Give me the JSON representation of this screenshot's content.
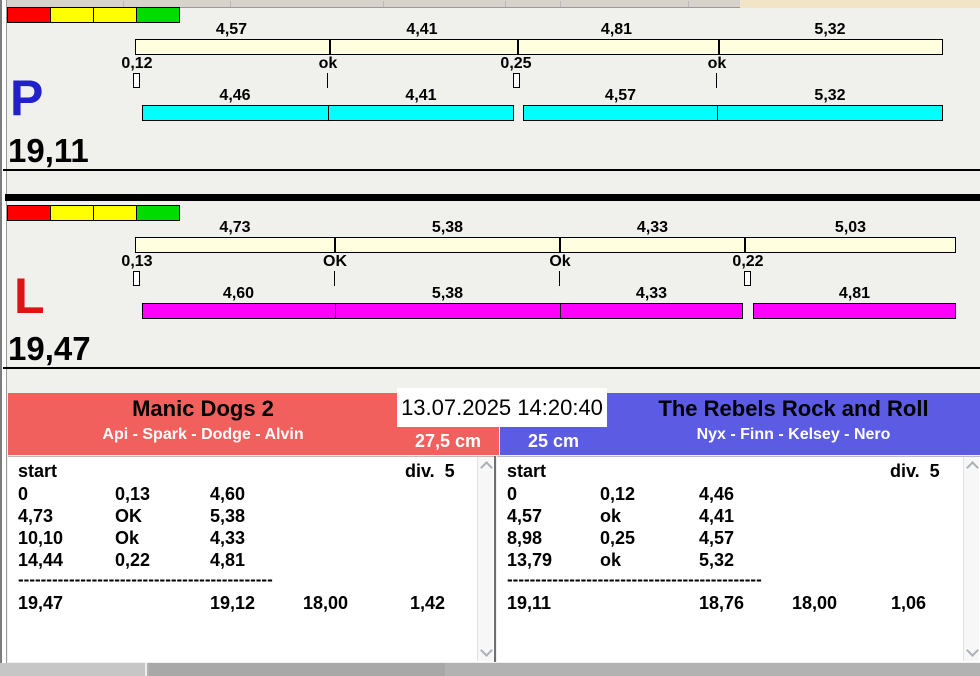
{
  "app": {
    "datetime": "13.07.2025 14:20:40",
    "colors": {
      "cream_bar": "#FFFFE0",
      "cyan_bar": "#00FFFF",
      "magenta_bar": "#FF00FF",
      "red_team": "#F2605E",
      "blue_team": "#5B5BE4",
      "p_letter": "#2020CC",
      "l_letter": "#DD1414"
    }
  },
  "lights": {
    "cells": [
      "#FF0000",
      "#FFFF00",
      "#FFFF00",
      "#00DC00"
    ]
  },
  "lane_p": {
    "letter": "P",
    "total": "19,11",
    "splits_top": [
      "4,57",
      "4,41",
      "4,81",
      "5,32"
    ],
    "marks": [
      "0,12",
      "ok",
      "0,25",
      "ok"
    ],
    "splits_bottom": [
      "4,46",
      "4,41",
      "4,57",
      "5,32"
    ]
  },
  "lane_l": {
    "letter": "L",
    "total": "19,47",
    "splits_top": [
      "4,73",
      "5,38",
      "4,33",
      "5,03"
    ],
    "marks": [
      "0,13",
      "OK",
      "Ok",
      "0,22"
    ],
    "splits_bottom": [
      "4,60",
      "5,38",
      "4,33",
      "4,81"
    ]
  },
  "left_team": {
    "name": "Manic Dogs 2",
    "dogs": "Api - Spark - Dodge - Alvin",
    "jump_height": "27,5 cm",
    "table": {
      "start_label": "start",
      "div_label": "div.  5",
      "rows": [
        [
          "0",
          "0,13",
          "4,60"
        ],
        [
          "4,73",
          "OK",
          "5,38"
        ],
        [
          "10,10",
          "Ok",
          "4,33"
        ],
        [
          "14,44",
          "0,22",
          "4,81"
        ]
      ],
      "divider": "---------------------------------------------",
      "totals": [
        "19,47",
        "19,12",
        "18,00",
        "1,42"
      ]
    }
  },
  "right_team": {
    "name": "The Rebels Rock and Roll",
    "dogs": "Nyx - Finn - Kelsey - Nero",
    "jump_height": "25 cm",
    "table": {
      "start_label": "start",
      "div_label": "div.  5",
      "rows": [
        [
          "0",
          "0,12",
          "4,46"
        ],
        [
          "4,57",
          "ok",
          "4,41"
        ],
        [
          "8,98",
          "0,25",
          "4,57"
        ],
        [
          "13,79",
          "ok",
          "5,32"
        ]
      ],
      "divider": "---------------------------------------------",
      "totals": [
        "19,11",
        "18,76",
        "18,00",
        "1,06"
      ]
    }
  }
}
